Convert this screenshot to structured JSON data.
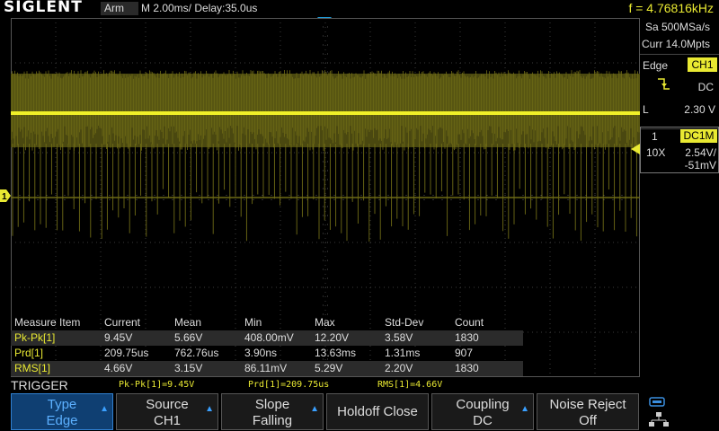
{
  "header": {
    "brand": "SIGLENT",
    "run_state": "Arm",
    "timebase": "M 2.00ms/ Delay:35.0us",
    "frequency": "f = 4.76816kHz"
  },
  "acquisition": {
    "sample_rate": "Sa 500MSa/s",
    "memory_depth": "Curr 14.0Mpts"
  },
  "trigger_panel": {
    "type": "Edge",
    "source": "CH1",
    "slope_icon": "falling-edge-icon",
    "coupling": "DC",
    "level_label": "L",
    "level": "2.30 V"
  },
  "channel_panel": {
    "number": "1",
    "coupling": "DC1M",
    "probe": "10X",
    "scale": "2.54V/",
    "offset": "-51mV"
  },
  "markers": {
    "channel_marker": "1",
    "trigger_level_marker": "◀",
    "trigger_position_marker": "▼"
  },
  "measurements": {
    "headers": [
      "Measure Item",
      "Current",
      "Mean",
      "Min",
      "Max",
      "Std-Dev",
      "Count"
    ],
    "rows": [
      [
        "Pk-Pk[1]",
        "9.45V",
        "5.66V",
        "408.00mV",
        "12.20V",
        "3.58V",
        "1830"
      ],
      [
        "Prd[1]",
        "209.75us",
        "762.76us",
        "3.90ns",
        "13.63ms",
        "1.31ms",
        "907"
      ],
      [
        "RMS[1]",
        "4.66V",
        "3.15V",
        "86.11mV",
        "5.29V",
        "2.20V",
        "1830"
      ]
    ]
  },
  "menu": {
    "title": "TRIGGER",
    "stats": [
      "Pk-Pk[1]=9.45V",
      "Prd[1]=209.75us",
      "RMS[1]=4.66V"
    ],
    "softkeys": [
      {
        "line1": "Type",
        "line2": "Edge",
        "arrow": "▲"
      },
      {
        "line1": "Source",
        "line2": "CH1",
        "arrow": "▲"
      },
      {
        "line1": "Slope",
        "line2": "Falling",
        "arrow": "▲"
      },
      {
        "line1": "Holdoff Close",
        "line2": "",
        "arrow": ""
      },
      {
        "line1": "Coupling",
        "line2": "DC",
        "arrow": "▲"
      },
      {
        "line1": "Noise Reject",
        "line2": "Off",
        "arrow": ""
      }
    ],
    "status_icons": [
      "usb-icon",
      "network-icon"
    ]
  },
  "colors": {
    "channel1": "#e9e932",
    "trace_fill": "#5c5a12",
    "trigger_marker": "#1e9bd7",
    "softkey_selected": "#0f3f72"
  }
}
